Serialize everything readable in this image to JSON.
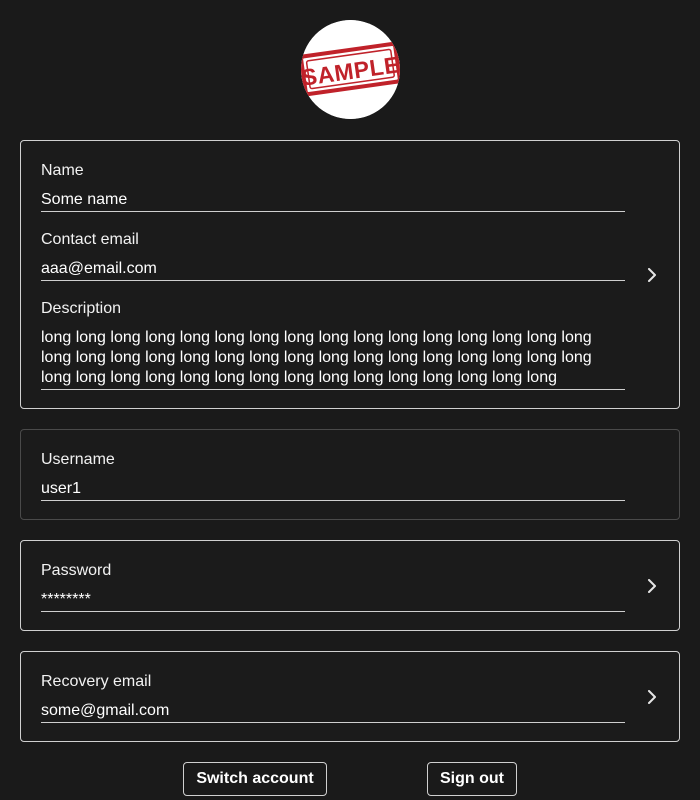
{
  "avatar": {
    "stamp_text": "SAMPLE",
    "stamp_color": "#c0222a"
  },
  "profile": {
    "name_label": "Name",
    "name_value": "Some name",
    "contact_email_label": "Contact email",
    "contact_email_value": "aaa@email.com",
    "description_label": "Description",
    "description_value": "long long long long long long long long long long long long long long long long long long long long long long long long long long long long long long long long long long long long long long long long long long long long long long long",
    "chevron_icon": "chevron-right-icon"
  },
  "username": {
    "label": "Username",
    "value": "user1"
  },
  "password": {
    "label": "Password",
    "value": "********",
    "chevron_icon": "chevron-right-icon"
  },
  "recovery_email": {
    "label": "Recovery email",
    "value": "some@gmail.com",
    "chevron_icon": "chevron-right-icon"
  },
  "actions": {
    "switch_account_label": "Switch account",
    "sign_out_label": "Sign out"
  },
  "colors": {
    "background": "#1a1a1a",
    "border": "#d0d0d0",
    "border_disabled": "#4a4a4a",
    "text": "#ffffff"
  }
}
